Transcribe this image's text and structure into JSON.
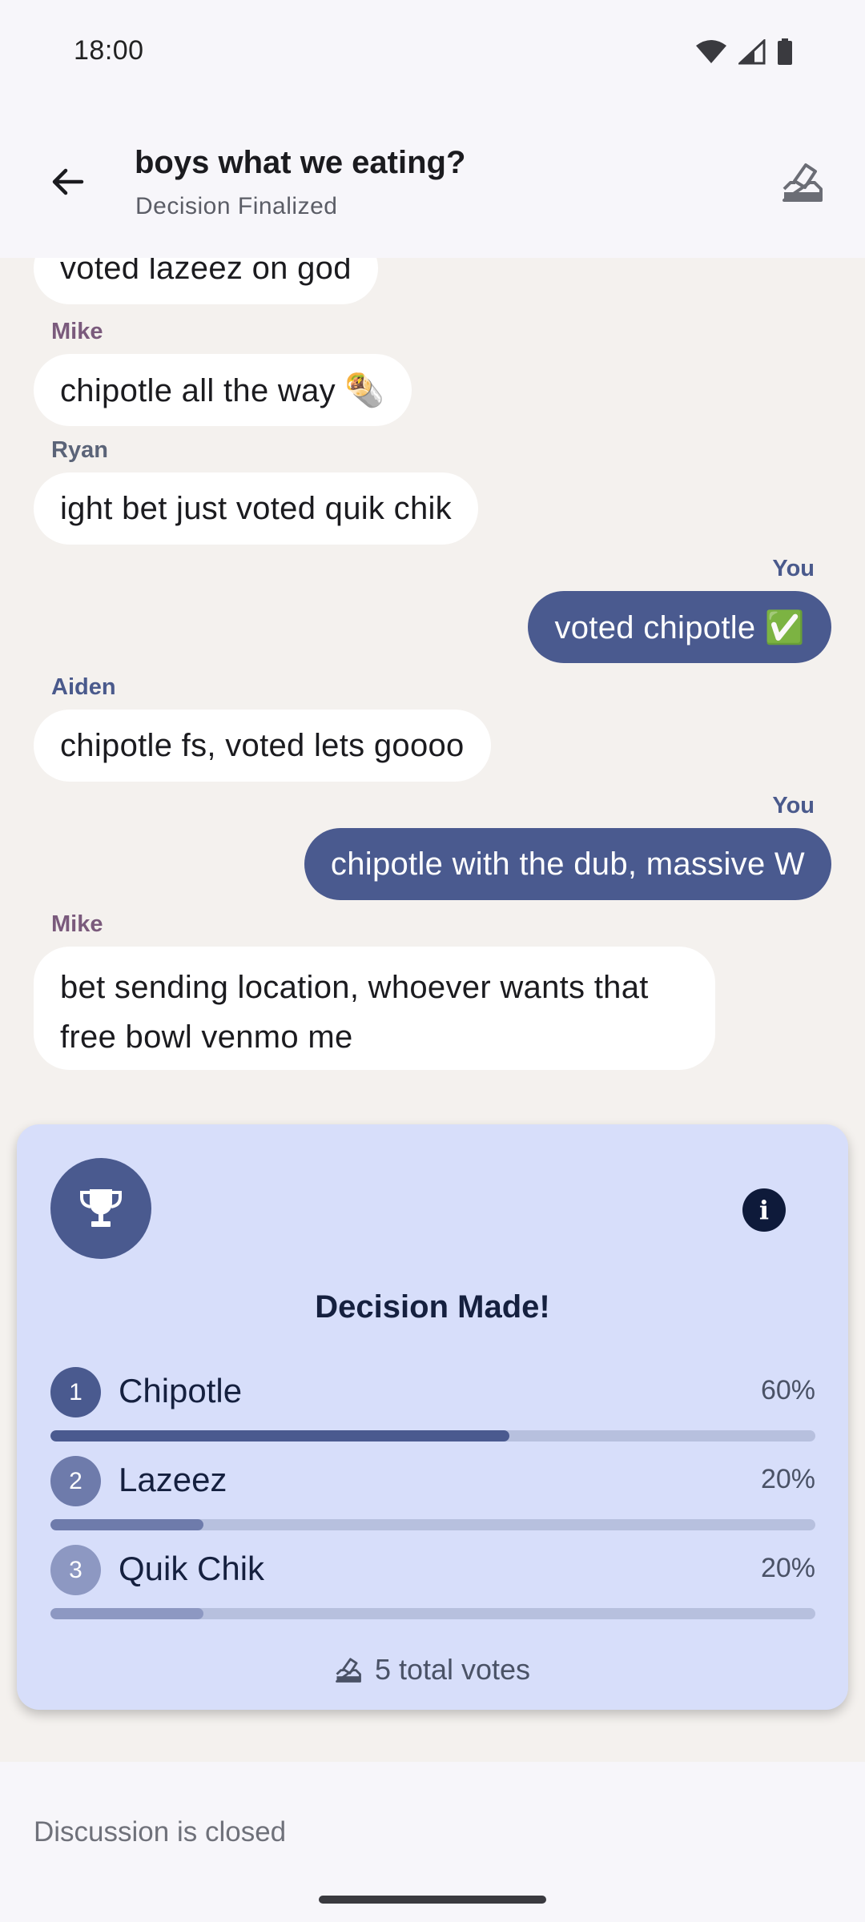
{
  "status_bar": {
    "time": "18:00",
    "icons": [
      "wifi-icon",
      "signal-icon",
      "battery-icon"
    ]
  },
  "header": {
    "title": "boys what we eating?",
    "subtitle": "Decision Finalized",
    "back_icon": "arrow-back-icon",
    "action_icon": "ballot-box-icon"
  },
  "messages": [
    {
      "sender": "",
      "text": "voted lazeez on god",
      "mine": false
    },
    {
      "sender": "Mike",
      "text": "chipotle all the way 🌯",
      "mine": false
    },
    {
      "sender": "Ryan",
      "text": "ight bet just voted quik chik",
      "mine": false
    },
    {
      "sender": "You",
      "text": "voted chipotle ✅",
      "mine": true
    },
    {
      "sender": "Aiden",
      "text": "chipotle fs, voted lets goooo",
      "mine": false
    },
    {
      "sender": "You",
      "text": "chipotle with the dub, massive W",
      "mine": true
    },
    {
      "sender": "Mike",
      "text": "bet sending location, whoever wants that free bowl venmo me",
      "mine": false
    }
  ],
  "decision": {
    "title": "Decision Made!",
    "trophy_icon": "trophy-icon",
    "info_icon": "info-icon",
    "options": [
      {
        "rank": "1",
        "name": "Chipotle",
        "percent_label": "60%",
        "fraction": 0.6
      },
      {
        "rank": "2",
        "name": "Lazeez",
        "percent_label": "20%",
        "fraction": 0.2
      },
      {
        "rank": "3",
        "name": "Quik Chik",
        "percent_label": "20%",
        "fraction": 0.2
      }
    ],
    "total_votes": "5 total votes"
  },
  "footer": {
    "closed_text": "Discussion is closed"
  },
  "colors": {
    "accent": "#4a5a8f",
    "rank2": "#6e7bab",
    "rank3": "#8d98c2",
    "card_bg": "#d7defa",
    "chat_bg": "#f4f1ee"
  }
}
